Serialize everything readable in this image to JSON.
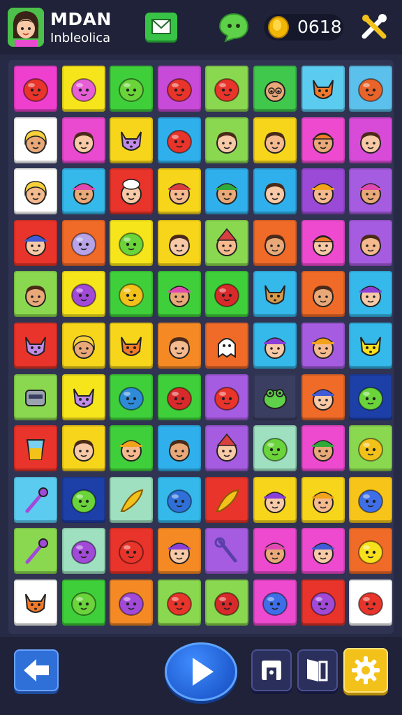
{
  "header": {
    "title": "MDAN",
    "subtitle": "Inbleolica",
    "coins": "0618"
  },
  "board": {
    "rows": [
      [
        "#ee3fcf",
        "#f7e51c",
        "#3fcf3a",
        "#c84ad8",
        "#8ad84f",
        "#3fc84b",
        "#5ccbf0",
        "#5cc0ec"
      ],
      [
        "#ffffff",
        "#e94ad0",
        "#f7d51a",
        "#2fb0ec",
        "#8ad84f",
        "#f7d51a",
        "#ee4ad0",
        "#d84ad8"
      ],
      [
        "#ffffff",
        "#35b8ea",
        "#e8342a",
        "#f7d51a",
        "#2fb0ec",
        "#2fb0ec",
        "#9b4ad8",
        "#a65ce0"
      ],
      [
        "#e8342a",
        "#f06a28",
        "#f7e51c",
        "#f7d51a",
        "#8ad84f",
        "#f06a28",
        "#ee4ad0",
        "#a65ce0"
      ],
      [
        "#8ad84f",
        "#f7e51c",
        "#3fcf3a",
        "#3fcf3a",
        "#3fcf3a",
        "#35b8ea",
        "#f06a28",
        "#35b8ea"
      ],
      [
        "#e8342a",
        "#f7d51a",
        "#f7d51a",
        "#f58a25",
        "#f06a28",
        "#35b8ea",
        "#a65ce0",
        "#35b8ea"
      ],
      [
        "#8ad84f",
        "#f7e51c",
        "#3fcf3a",
        "#3fcf3a",
        "#a65ce0",
        "#3a3f62",
        "#f06a28",
        "#1d3fa8"
      ],
      [
        "#e8342a",
        "#f7d51a",
        "#3fcf3a",
        "#2fb0ec",
        "#a65ce0",
        "#9ee0c0",
        "#ee4ad0",
        "#8ad84f"
      ],
      [
        "#5ccbf0",
        "#1d3fa8",
        "#9ee0c0",
        "#35b8ea",
        "#e8342a",
        "#f7d51a",
        "#f7d51a",
        "#f7c51a"
      ],
      [
        "#8ad84f",
        "#9ee0c0",
        "#e8342a",
        "#f58a25",
        "#a65ce0",
        "#ee4ad0",
        "#ee4ad0",
        "#f06a28"
      ],
      [
        "#ffffff",
        "#3fcf3a",
        "#f58a25",
        "#8ad84f",
        "#8ad84f",
        "#ee4ad0",
        "#e8342a",
        "#ffffff"
      ]
    ],
    "pieces": [
      [
        "blob-red",
        "blob-pink",
        "blob-green",
        "blob-red",
        "blob-red",
        "face-glasses",
        "face-fox",
        "blob-drop"
      ],
      [
        "face-blonde",
        "face-kid",
        "face-cat",
        "blob-red",
        "face-hair",
        "face-kid",
        "face-clown",
        "face-kid"
      ],
      [
        "face-blonde",
        "face-cap",
        "face-chef",
        "face-hat",
        "face-cap",
        "face-kid",
        "face-hat",
        "face-cap"
      ],
      [
        "face-hat",
        "blob-ghost",
        "blob-green",
        "face-kid",
        "face-gnome",
        "face-kid",
        "face-clown",
        "face-kid"
      ],
      [
        "face-kid",
        "blob-plum",
        "blob-pear",
        "face-cap",
        "blob-apple",
        "face-deer",
        "face-kid",
        "face-cap"
      ],
      [
        "face-cat",
        "face-blonde",
        "face-fox",
        "face-kid",
        "face-ghost",
        "face-cap",
        "face-cap",
        "face-duck"
      ],
      [
        "face-robot",
        "face-cat",
        "blob-ball",
        "blob-apple",
        "blob-red",
        "face-frog",
        "face-hat",
        "blob-green"
      ],
      [
        "item-glass",
        "face-kid",
        "face-cap",
        "face-kid",
        "face-gnome",
        "blob-green",
        "face-cap",
        "blob-pear"
      ],
      [
        "item-wand",
        "blob-green",
        "item-key",
        "blob-bird",
        "item-feather",
        "face-hat",
        "face-cap",
        "blob-blue"
      ],
      [
        "item-leaf",
        "blob-plum",
        "blob-red",
        "face-hat",
        "item-wrench",
        "face-hat",
        "face-hat",
        "blob-yellow"
      ],
      [
        "face-fox",
        "blob-green",
        "blob-plum",
        "blob-red",
        "blob-apple",
        "blob-blue",
        "blob-plum",
        "blob-red"
      ]
    ]
  },
  "icons": {
    "avatar": "girl-avatar-icon",
    "mail": "mail-icon",
    "chat": "chat-bubble-icon",
    "coin": "coin-icon",
    "tools": "tools-icon",
    "back": "back-arrow-icon",
    "play": "play-icon",
    "share": "share-icon",
    "exit": "exit-door-icon",
    "settings": "gear-icon"
  },
  "colors": {
    "background": "#262a45",
    "bar": "#1f2238",
    "accent_blue": "#2f6fd8",
    "accent_gold": "#f2c21b"
  }
}
